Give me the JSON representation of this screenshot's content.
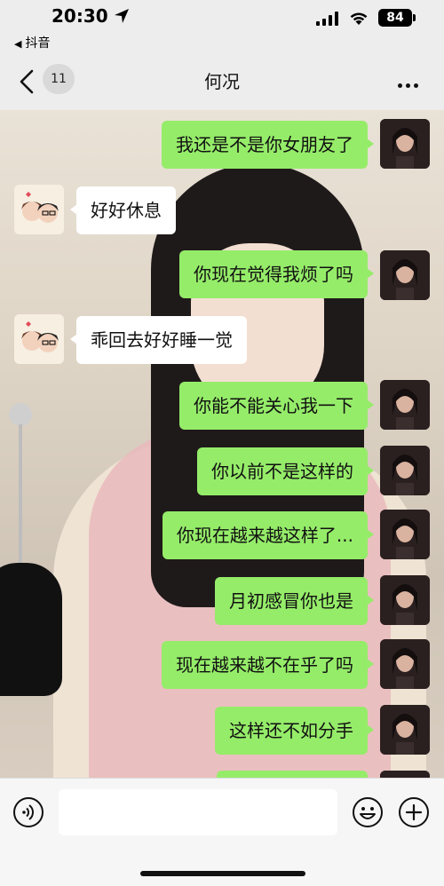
{
  "status_bar": {
    "time": "20:30",
    "back_app": "抖音",
    "battery": "84"
  },
  "nav": {
    "unread_count": "11",
    "title": "何况"
  },
  "messages": [
    {
      "side": "out",
      "text": "我还是不是你女朋友了"
    },
    {
      "side": "in",
      "text": "好好休息"
    },
    {
      "side": "out",
      "text": "你现在觉得我烦了吗"
    },
    {
      "side": "in",
      "text": "乖回去好好睡一觉"
    },
    {
      "side": "out",
      "text": "你能不能关心我一下"
    },
    {
      "side": "out",
      "text": "你以前不是这样的"
    },
    {
      "side": "out",
      "text": "你现在越来越这样了..."
    },
    {
      "side": "out",
      "text": "月初感冒你也是"
    },
    {
      "side": "out",
      "text": "现在越来越不在乎了吗"
    },
    {
      "side": "out",
      "text": "这样还不如分手"
    }
  ],
  "colors": {
    "outgoing_bubble": "#95ec69",
    "incoming_bubble": "#ffffff",
    "chrome_bg": "#ededed"
  },
  "icons": [
    "location-arrow-icon",
    "signal-icon",
    "wifi-icon",
    "back-chevron-icon",
    "more-icon",
    "voice-icon",
    "emoji-icon",
    "plus-icon"
  ]
}
